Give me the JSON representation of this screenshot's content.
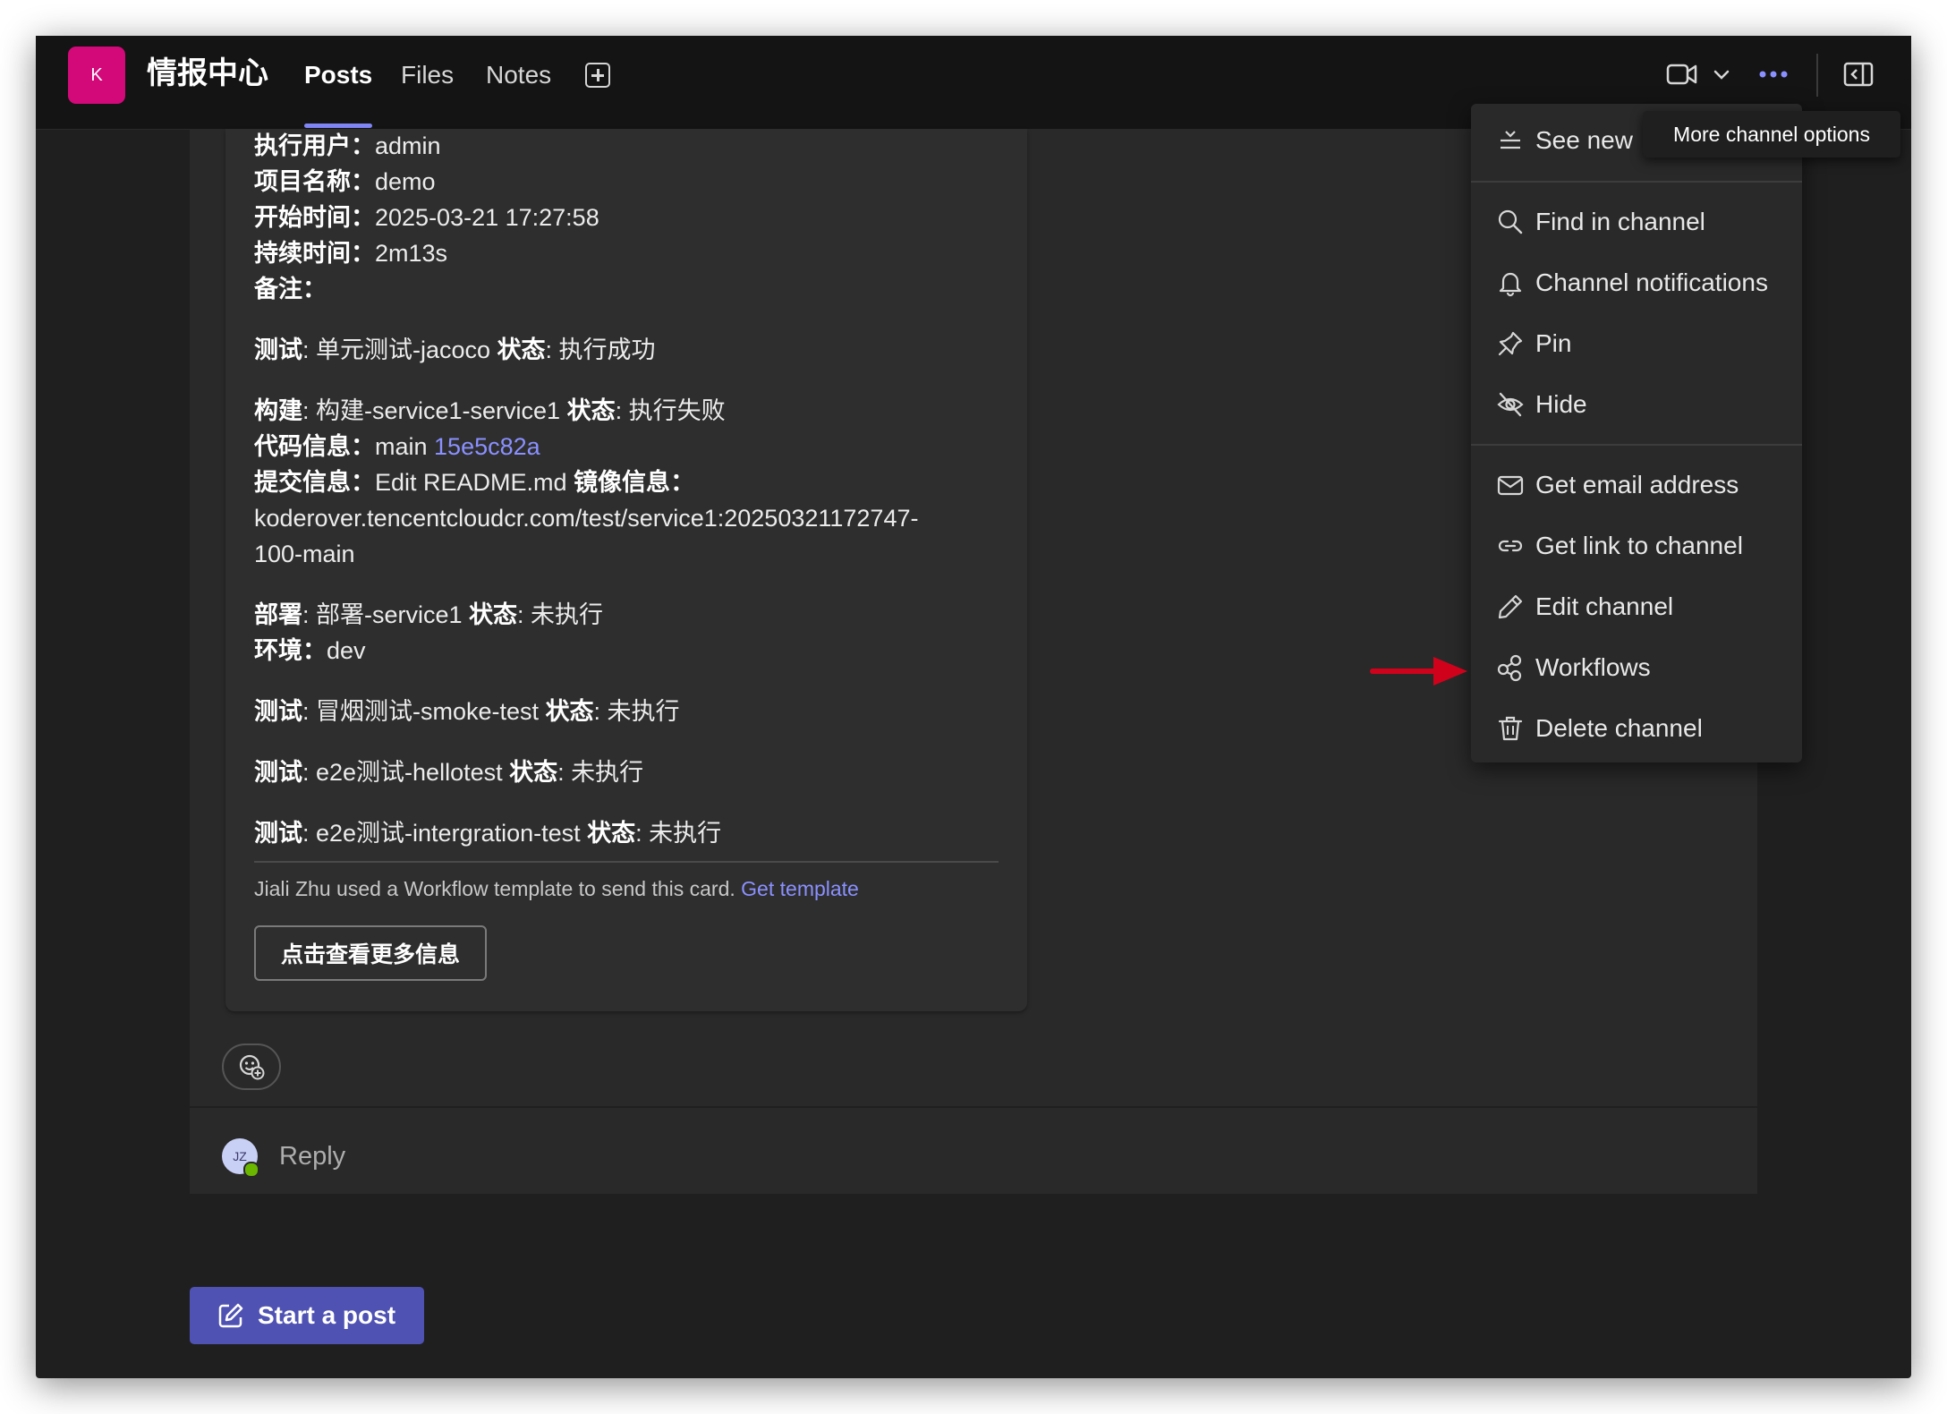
{
  "header": {
    "team_avatar_initial": "K",
    "channel_name": "情报中心",
    "tabs": [
      {
        "label": "Posts",
        "active": true
      },
      {
        "label": "Files",
        "active": false
      },
      {
        "label": "Notes",
        "active": false
      }
    ],
    "icons": [
      "add-tab-icon",
      "video-call-icon",
      "chevron-down-icon",
      "more-options-icon",
      "open-side-panel-icon"
    ]
  },
  "card": {
    "rows": [
      {
        "label": "执行用户",
        "sep": "：",
        "value": "admin"
      },
      {
        "label": "项目名称",
        "sep": "：",
        "value": "demo"
      },
      {
        "label": "开始时间",
        "sep": "：",
        "value": "2025-03-21 17:27:58"
      },
      {
        "label": "持续时间",
        "sep": "：",
        "value": "2m13s"
      },
      {
        "label": "备注",
        "sep": "：",
        "value": ""
      }
    ],
    "test1": {
      "label": "测试",
      "name": ": 单元测试-jacoco ",
      "status_label": "状态",
      "status": ": 执行成功"
    },
    "build": {
      "label": "构建",
      "name": ": 构建-service1-service1 ",
      "status_label": "状态",
      "status": ": 执行失败"
    },
    "code": {
      "label": "代码信息",
      "sep": "：",
      "value": "main ",
      "commit": "15e5c82a"
    },
    "commit_msg": {
      "label": "提交信息",
      "sep": "：",
      "value": "Edit README.md ",
      "image_label": "镜像信息",
      "image_sep": "：",
      "image_line1": "koderover.tencentcloudcr.com/test/service1:20250321172747-",
      "image_line2": "100-main"
    },
    "deploy": {
      "label": "部署",
      "name": ": 部署-service1 ",
      "status_label": "状态",
      "status": ": 未执行"
    },
    "env": {
      "label": "环境",
      "sep": "：",
      "value": "dev"
    },
    "test2": {
      "label": "测试",
      "name": ": 冒烟测试-smoke-test ",
      "status_label": "状态",
      "status": ": 未执行"
    },
    "test3": {
      "label": "测试",
      "name": ": e2e测试-hellotest ",
      "status_label": "状态",
      "status": ": 未执行"
    },
    "test4": {
      "label": "测试",
      "name": ": e2e测试-intergration-test ",
      "status_label": "状态",
      "status": ": 未执行"
    },
    "footer_text": "Jiali Zhu used a Workflow template to send this card. ",
    "footer_link": "Get template",
    "button_label": "点击查看更多信息"
  },
  "reply": {
    "avatar_initials": "JZ",
    "label": "Reply"
  },
  "start_post": {
    "label": "Start a post"
  },
  "tooltip": "More channel options",
  "menu": {
    "items": [
      {
        "label": "See new",
        "icon": "see-new-icon"
      },
      {
        "label": "Find in channel",
        "icon": "search-icon"
      },
      {
        "label": "Channel notifications",
        "icon": "bell-icon"
      },
      {
        "label": "Pin",
        "icon": "pin-icon"
      },
      {
        "label": "Hide",
        "icon": "eye-off-icon"
      },
      {
        "label": "Get email address",
        "icon": "mail-icon"
      },
      {
        "label": "Get link to channel",
        "icon": "link-icon"
      },
      {
        "label": "Edit channel",
        "icon": "pencil-icon"
      },
      {
        "label": "Workflows",
        "icon": "workflows-icon"
      },
      {
        "label": "Delete channel",
        "icon": "trash-icon"
      }
    ]
  },
  "colors": {
    "accent": "#7f85f5",
    "team_avatar": "#d3097a",
    "start_post_bg": "#4f52b2",
    "annotation_arrow": "#d0021b"
  }
}
